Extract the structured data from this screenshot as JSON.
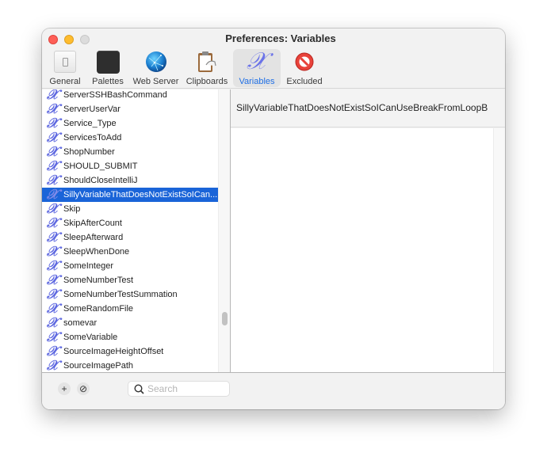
{
  "window": {
    "title": "Preferences: Variables"
  },
  "toolbar": {
    "items": [
      {
        "label": "General",
        "icon": "general-switch-icon",
        "active": false
      },
      {
        "label": "Palettes",
        "icon": "palettes-icon",
        "active": false
      },
      {
        "label": "Web Server",
        "icon": "web-server-globe-icon",
        "active": false
      },
      {
        "label": "Clipboards",
        "icon": "clipboard-icon",
        "active": false
      },
      {
        "label": "Variables",
        "icon": "variable-x-icon",
        "active": true
      },
      {
        "label": "Excluded",
        "icon": "excluded-prohibited-icon",
        "active": false
      }
    ]
  },
  "variables": {
    "icon_glyph": "𝒳",
    "selected_index": 7,
    "items": [
      "ServerSSHBashCommand",
      "ServerUserVar",
      "Service_Type",
      "ServicesToAdd",
      "ShopNumber",
      "SHOULD_SUBMIT",
      "ShouldCloseIntelliJ",
      "SillyVariableThatDoesNotExistSoICan...",
      "Skip",
      "SkipAfterCount",
      "SleepAfterward",
      "SleepWhenDone",
      "SomeInteger",
      "SomeNumberTest",
      "SomeNumberTestSummation",
      "SomeRandomFile",
      "somevar",
      "SomeVariable",
      "SourceImageHeightOffset",
      "SourceImagePath"
    ]
  },
  "detail": {
    "name": "SillyVariableThatDoesNotExistSoICanUseBreakFromLoopB",
    "value": ""
  },
  "bottom": {
    "add_label": "+",
    "remove_label": "⊘",
    "search_placeholder": "Search",
    "search_value": ""
  },
  "colors": {
    "accent": "#1a64d8",
    "variable_icon": "#5e68e0",
    "active_tab_label": "#1f6fe5"
  }
}
